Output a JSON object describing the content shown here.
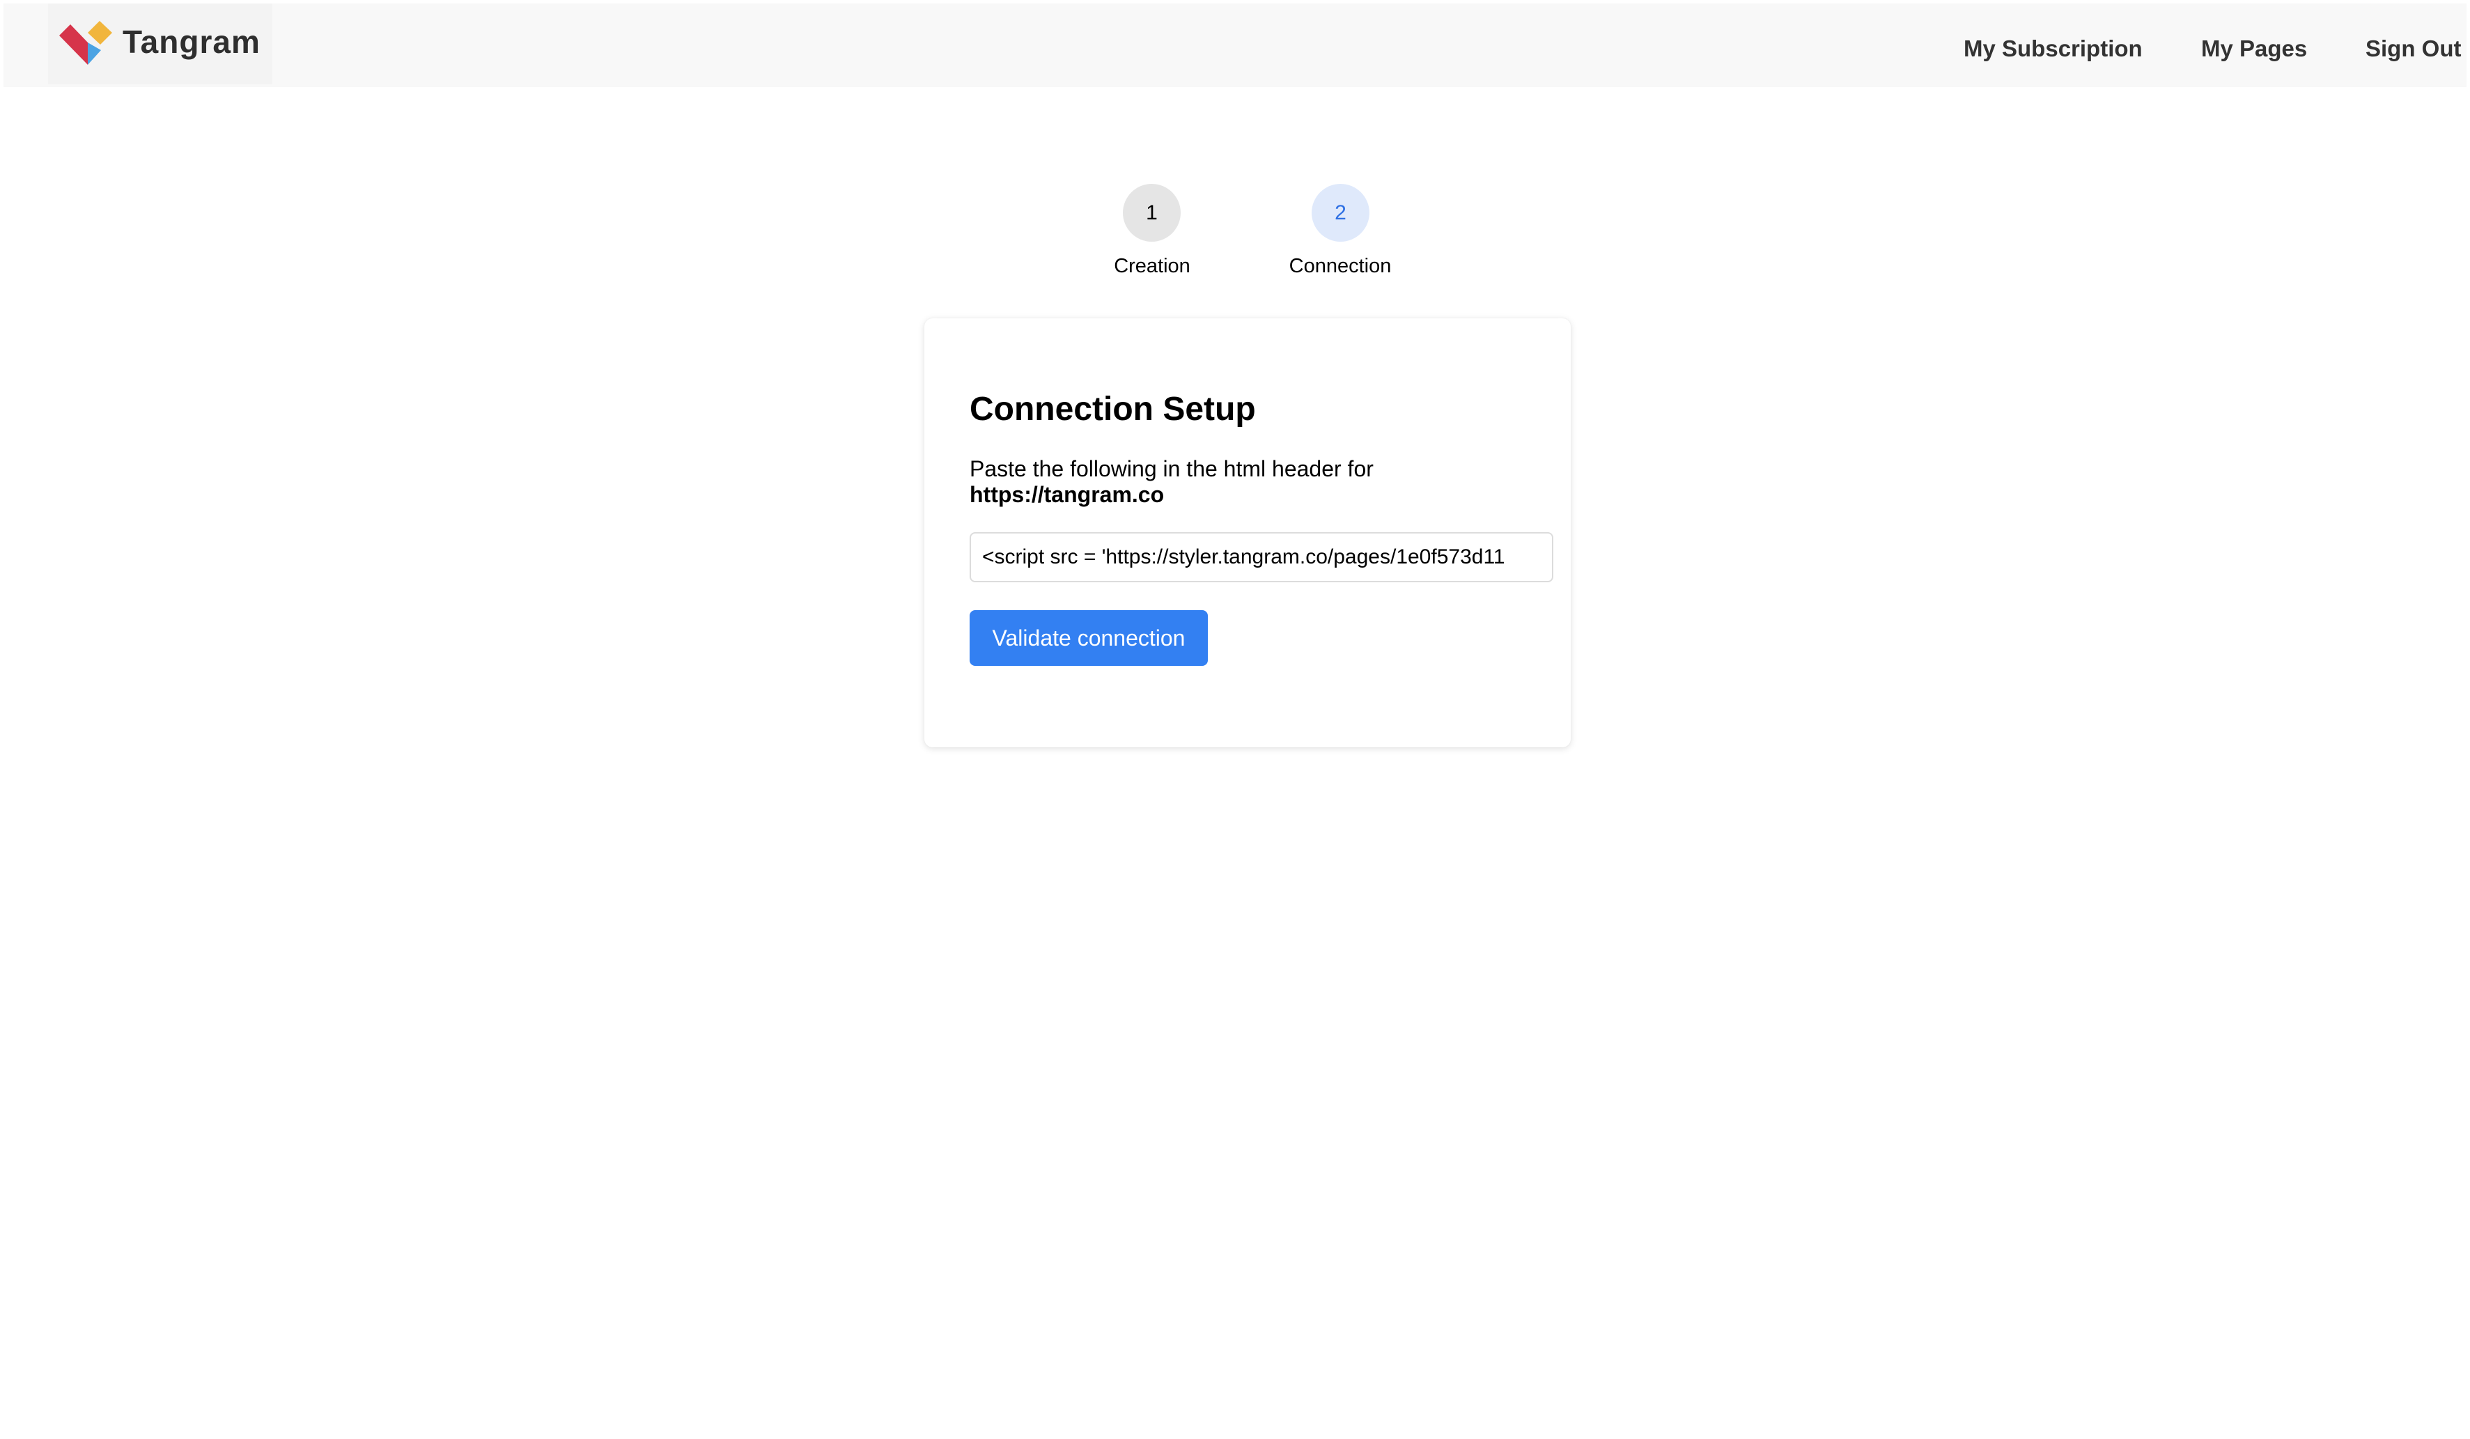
{
  "header": {
    "brand_name": "Tangram",
    "logo_colors": [
      "#d6344a",
      "#f1b53c",
      "#4ba3e3"
    ],
    "nav": {
      "subscription": "My Subscription",
      "pages": "My Pages",
      "sign_out": "Sign Out"
    }
  },
  "stepper": {
    "current_step": 2,
    "steps": [
      {
        "number": "1",
        "label": "Creation"
      },
      {
        "number": "2",
        "label": "Connection"
      }
    ]
  },
  "card": {
    "title": "Connection Setup",
    "description": "Paste the following in the html header for",
    "domain": "https://tangram.co",
    "snippet_value": "<script src = 'https://styler.tangram.co/pages/1e0f573d11",
    "validate_label": "Validate connection"
  },
  "colors": {
    "accent": "#3380f2",
    "active_step_bg": "#dfe9fb",
    "active_step_text": "#2d6fe3",
    "inactive_step_bg": "#e5e5e5",
    "header_bg": "#f8f8f8"
  }
}
